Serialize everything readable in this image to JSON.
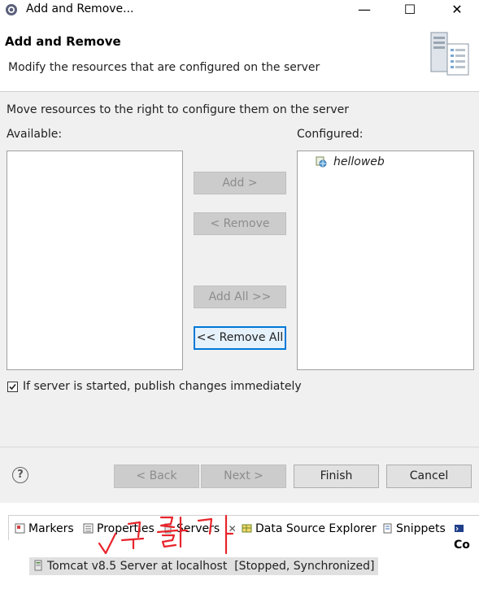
{
  "window": {
    "title": "Add and Remove...",
    "minimize": "—",
    "maximize": "☐",
    "close": "✕"
  },
  "header": {
    "title": "Add and Remove",
    "description": "Modify the resources that are configured on the server"
  },
  "body": {
    "instruction": "Move resources to the right to configure them on the server",
    "available_label": "Available:",
    "configured_label": "Configured:",
    "configured_items": [
      "helloweb"
    ],
    "buttons": {
      "add": "Add >",
      "remove": "< Remove",
      "add_all": "Add All >>",
      "remove_all": "<< Remove All"
    },
    "publish_checkbox": {
      "label": "If server is started, publish changes immediately",
      "checked": true
    }
  },
  "footer": {
    "help": "?",
    "back": "< Back",
    "next": "Next >",
    "finish": "Finish",
    "cancel": "Cancel"
  },
  "views": {
    "tabs": [
      "Markers",
      "Properties",
      "Servers",
      "Data Source Explorer",
      "Snippets",
      "Co"
    ],
    "servers_close": "✕",
    "server_entry": "Tomcat v8.5 Server at localhost  [Stopped, Synchronized]"
  },
  "colors": {
    "focus_border": "#0078d7",
    "annotation": "#e8242b"
  }
}
